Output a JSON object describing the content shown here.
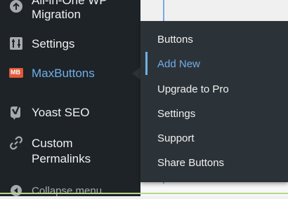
{
  "sidebar": {
    "items": [
      {
        "label_line1": "All-in-One WP",
        "label_line2": "Migration",
        "icon": "migration-icon"
      },
      {
        "label": "Settings",
        "icon": "settings-sliders-icon"
      },
      {
        "label": "MaxButtons",
        "icon": "maxbuttons-logo-icon",
        "icon_text": "MB",
        "active": true
      },
      {
        "label": "Yoast SEO",
        "icon": "yoast-logo-icon"
      },
      {
        "label_line1": "Custom",
        "label_line2": "Permalinks",
        "icon": "link-icon"
      }
    ],
    "collapse_label": "Collapse menu"
  },
  "flyout": {
    "items": [
      {
        "label": "Buttons"
      },
      {
        "label": "Add New",
        "highlighted": true
      },
      {
        "label": "Upgrade to Pro"
      },
      {
        "label": "Settings"
      },
      {
        "label": "Support"
      },
      {
        "label": "Share Buttons"
      }
    ]
  },
  "colors": {
    "sidebar_bg": "#1d2327",
    "flyout_bg": "#2c3338",
    "accent_blue": "#72aee6",
    "text": "#f0f0f1",
    "maxbuttons_logo": "#e05a3a"
  }
}
